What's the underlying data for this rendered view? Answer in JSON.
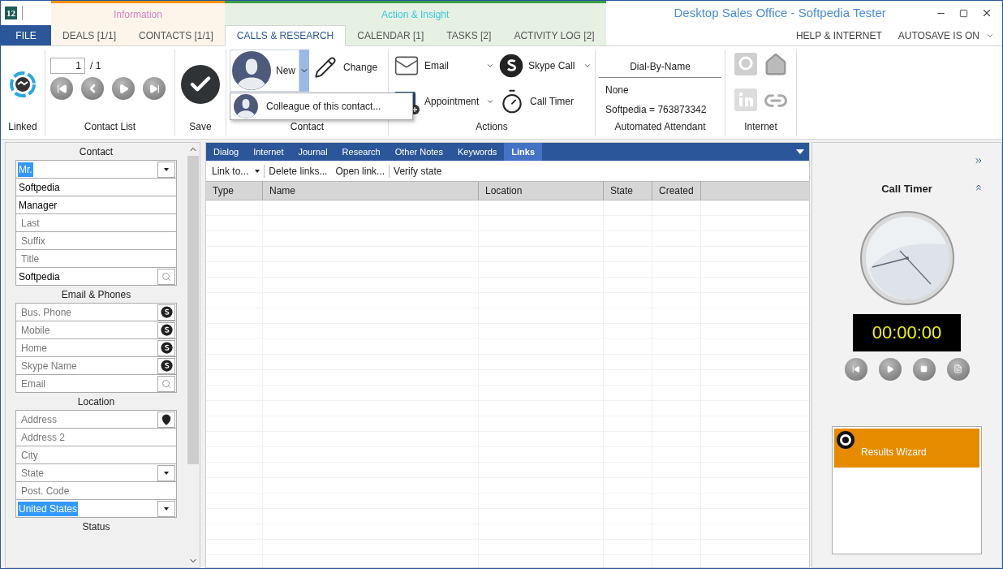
{
  "window": {
    "logo": "12",
    "title": "Desktop Sales Office - Softpedia Tester"
  },
  "file_tab": "FILE",
  "tab_groups": [
    {
      "label": "Information",
      "color": "#f39200",
      "tabs": [
        {
          "label": "DEALS [1/1]",
          "selected": false
        },
        {
          "label": "CONTACTS [1/1]",
          "selected": false
        }
      ]
    },
    {
      "label": "Action & Insight",
      "color": "#3a9e48",
      "tabs": [
        {
          "label": "CALLS & RESEARCH",
          "selected": true
        },
        {
          "label": "CALENDAR [1]",
          "selected": false
        },
        {
          "label": "TASKS [2]",
          "selected": false
        },
        {
          "label": "ACTIVITY LOG [2]",
          "selected": false
        }
      ]
    }
  ],
  "right_menu": [
    {
      "label": "HELP & INTERNET",
      "kind": "plain"
    },
    {
      "label": "AUTOSAVE IS ON",
      "kind": "dropdown"
    }
  ],
  "ribbon": {
    "linked": {
      "label": "Linked"
    },
    "contact_list": {
      "page": "1",
      "total": "/ 1",
      "label": "Contact List"
    },
    "save": {
      "label": "Save"
    },
    "contact": {
      "new": "New",
      "change": "Change",
      "label": "Contact"
    },
    "actions": {
      "items": [
        {
          "label": "Email",
          "kind": "email"
        },
        {
          "label": "Skype Call",
          "kind": "skype"
        },
        {
          "label": "Appointment",
          "kind": "appointment"
        },
        {
          "label": "Call Timer",
          "kind": "timer"
        }
      ],
      "label": "Actions"
    },
    "attendant": {
      "header": "Dial-By-Name",
      "lines": [
        "None",
        "Softpedia = 763873342"
      ],
      "label": "Automated Attendant"
    },
    "internet": {
      "label": "Internet"
    }
  },
  "dropdown_menu": {
    "items": [
      "Colleague of this contact..."
    ]
  },
  "contact_panel": {
    "sections": [
      {
        "title": "Contact",
        "fields": [
          {
            "value": "Mr.",
            "kind": "dropdown",
            "selected": true
          },
          {
            "value": "Softpedia",
            "kind": "text",
            "selected": false
          },
          {
            "value": "Manager",
            "kind": "text",
            "selected": false
          },
          {
            "placeholder": "Last",
            "kind": "text",
            "selected": false
          },
          {
            "placeholder": "Suffix",
            "kind": "text",
            "selected": false
          },
          {
            "placeholder": "Title",
            "kind": "text",
            "selected": false
          },
          {
            "value": "Softpedia",
            "kind": "search",
            "selected": false
          }
        ]
      },
      {
        "title": "Email & Phones",
        "fields": [
          {
            "placeholder": "Bus. Phone",
            "kind": "skype",
            "selected": false
          },
          {
            "placeholder": "Mobile",
            "kind": "skype",
            "selected": false
          },
          {
            "placeholder": "Home",
            "kind": "skype",
            "selected": false
          },
          {
            "placeholder": "Skype Name",
            "kind": "skype",
            "selected": false
          },
          {
            "placeholder": "Email",
            "kind": "search",
            "selected": false
          }
        ]
      },
      {
        "title": "Location",
        "fields": [
          {
            "placeholder": "Address",
            "kind": "pin",
            "selected": false
          },
          {
            "placeholder": "Address 2",
            "kind": "text",
            "selected": false
          },
          {
            "placeholder": "City",
            "kind": "text",
            "selected": false
          },
          {
            "placeholder": "State",
            "kind": "dropdown",
            "selected": false
          },
          {
            "placeholder": "Post. Code",
            "kind": "text",
            "selected": false
          },
          {
            "value": "United States",
            "kind": "dropdown",
            "selected": true
          }
        ]
      },
      {
        "title": "Status"
      }
    ]
  },
  "notes_tabs": [
    {
      "label": "Dialog",
      "selected": false
    },
    {
      "label": "Internet",
      "selected": false
    },
    {
      "label": "Journal",
      "selected": false
    },
    {
      "label": "Research",
      "selected": false
    },
    {
      "label": "Other Notes",
      "selected": false
    },
    {
      "label": "Keywords",
      "selected": false
    },
    {
      "label": "Links",
      "selected": true
    }
  ],
  "links_toolbar": [
    {
      "label": "Link to...",
      "kind": "dropdown"
    },
    {
      "label": "Delete links...",
      "kind": "plain"
    },
    {
      "label": "Open link...",
      "kind": "plain"
    },
    {
      "label": "Verify state",
      "kind": "plain"
    }
  ],
  "links_table": {
    "columns": [
      "Type",
      "Name",
      "Location",
      "State",
      "Created"
    ]
  },
  "call_timer": {
    "title": "Call Timer",
    "display": "00:00:00"
  },
  "results_wizard": {
    "label": "Results Wizard"
  }
}
